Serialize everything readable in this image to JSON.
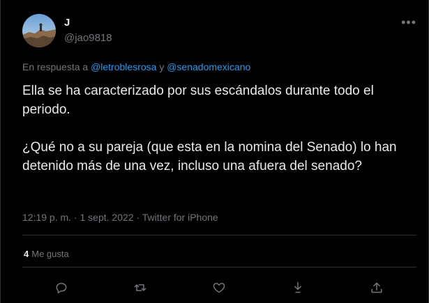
{
  "tweet": {
    "display_name": "J",
    "handle": "@jao9818",
    "more_icon": "more-horizontal-icon",
    "reply_prefix": "En respuesta a",
    "reply_mention_1": "@letroblesrosa",
    "reply_conjunction": "y",
    "reply_mention_2": "@senadomexicano",
    "paragraph_1": "Ella se ha caracterizado por sus escándalos durante todo el periodo.",
    "paragraph_2": "¿Qué no a su pareja (que esta en la nomina del Senado) lo han detenido más de una vez, incluso una afuera del senado?",
    "time": "12:19 p. m.",
    "date": "1 sept. 2022",
    "source": "Twitter for iPhone",
    "likes_count": "4",
    "likes_label": "Me gusta",
    "colors": {
      "background": "#000000",
      "text": "#e7e9ea",
      "secondary": "#71767b",
      "link": "#1d9bf0",
      "border": "#2f3336"
    },
    "action_icons": [
      "reply-icon",
      "retweet-icon",
      "like-icon",
      "share-down-icon",
      "share-up-icon"
    ]
  }
}
